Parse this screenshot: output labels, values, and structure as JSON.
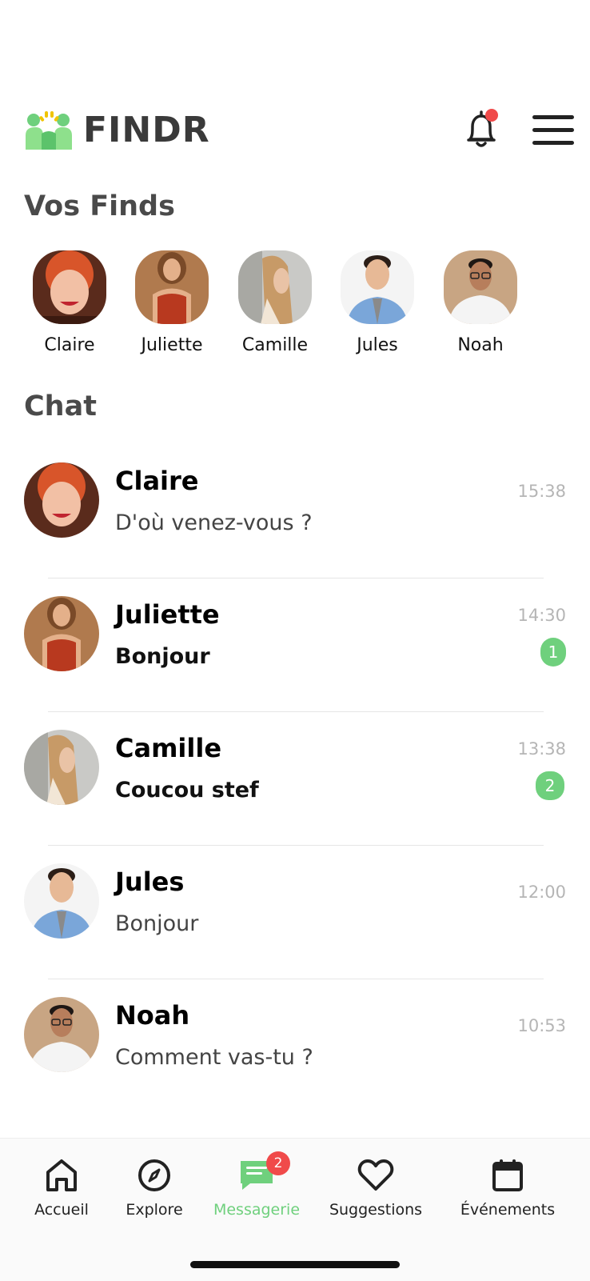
{
  "brand": {
    "name": "FINDR",
    "accent": "#6fd07d",
    "notification_dot": "#f04a4a"
  },
  "header": {
    "bell_icon": "bell-icon",
    "menu_icon": "hamburger-menu-icon",
    "has_notification": true
  },
  "finds": {
    "title": "Vos Finds",
    "items": [
      {
        "name": "Claire"
      },
      {
        "name": "Juliette"
      },
      {
        "name": "Camille"
      },
      {
        "name": "Jules"
      },
      {
        "name": "Noah"
      }
    ]
  },
  "chat": {
    "title": "Chat",
    "items": [
      {
        "name": "Claire",
        "message": "D'où venez-vous ?",
        "time": "15:38",
        "unread": null
      },
      {
        "name": "Juliette",
        "message": "Bonjour",
        "time": "14:30",
        "unread": "1"
      },
      {
        "name": "Camille",
        "message": "Coucou stef",
        "time": "13:38",
        "unread": "2"
      },
      {
        "name": "Jules",
        "message": "Bonjour",
        "time": "12:00",
        "unread": null
      },
      {
        "name": "Noah",
        "message": "Comment vas-tu ?",
        "time": "10:53",
        "unread": null
      }
    ]
  },
  "nav": {
    "active": "Messagerie",
    "items": [
      {
        "label": "Accueil",
        "icon": "home-icon"
      },
      {
        "label": "Explore",
        "icon": "compass-icon"
      },
      {
        "label": "Messagerie",
        "icon": "chat-icon",
        "badge": "2"
      },
      {
        "label": "Suggestions",
        "icon": "heart-icon"
      },
      {
        "label": "Événements",
        "icon": "calendar-icon"
      }
    ]
  }
}
